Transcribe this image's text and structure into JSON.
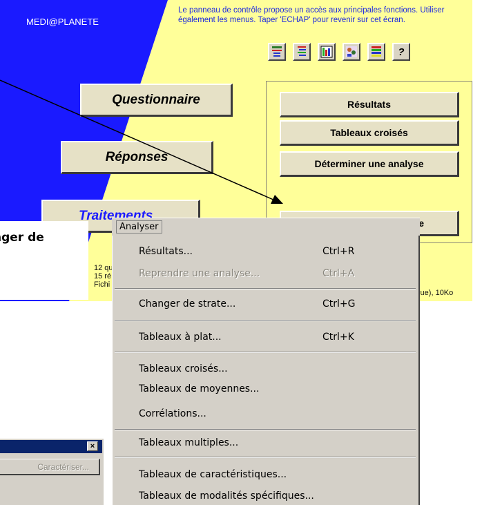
{
  "panel": {
    "brand": "MEDI@PLANETE",
    "instruction": "Le panneau de contrôle propose un accès aux principales fonctions. Utiliser également les menus. Taper 'ECHAP'  pour revenir sur cet écran.",
    "toolbar_icons": [
      "list-icon",
      "outline-icon",
      "table-chart-icon",
      "people-chart-icon",
      "color-list-icon",
      "help-icon"
    ],
    "help_label": "?",
    "buttons": {
      "questionnaire": "Questionnaire",
      "reponses": "Réponses",
      "traitements": "Traitements"
    },
    "group_buttons": {
      "resultats": "Résultats",
      "tableaux_croises": "Tableaux croisés",
      "determiner": "Déterminer une analyse",
      "hidden_suffix": "e"
    },
    "info_lines": [
      "12 qu",
      "15 ré",
      "Fichi"
    ],
    "info_right": "ique), 10Ko",
    "colors": {
      "blue": "#1a1aff",
      "yellow": "#ffff99",
      "button": "#e6e1c6"
    }
  },
  "callout": {
    "text": "nger de"
  },
  "dialog": {
    "close_label": "×",
    "caracteriser_label": "Caractériser..."
  },
  "menu": {
    "title": "Analyser",
    "items": [
      {
        "label": "Résultats...",
        "shortcut": "Ctrl+R",
        "disabled": false
      },
      {
        "label": "Reprendre une analyse...",
        "shortcut": "Ctrl+A",
        "disabled": true
      },
      {
        "label": "Changer de strate...",
        "shortcut": "Ctrl+G",
        "disabled": false
      },
      {
        "label": "Tableaux à plat...",
        "shortcut": "Ctrl+K",
        "disabled": false
      },
      {
        "label": "Tableaux croisés...",
        "shortcut": "",
        "disabled": false
      },
      {
        "label": "Tableaux de moyennes...",
        "shortcut": "",
        "disabled": false
      },
      {
        "label": "Corrélations...",
        "shortcut": "",
        "disabled": false
      },
      {
        "label": "Tableaux multiples...",
        "shortcut": "",
        "disabled": false
      },
      {
        "label": "Tableaux de caractéristiques...",
        "shortcut": "",
        "disabled": false
      },
      {
        "label": "Tableaux de modalités spécifiques...",
        "shortcut": "",
        "disabled": false
      }
    ]
  }
}
